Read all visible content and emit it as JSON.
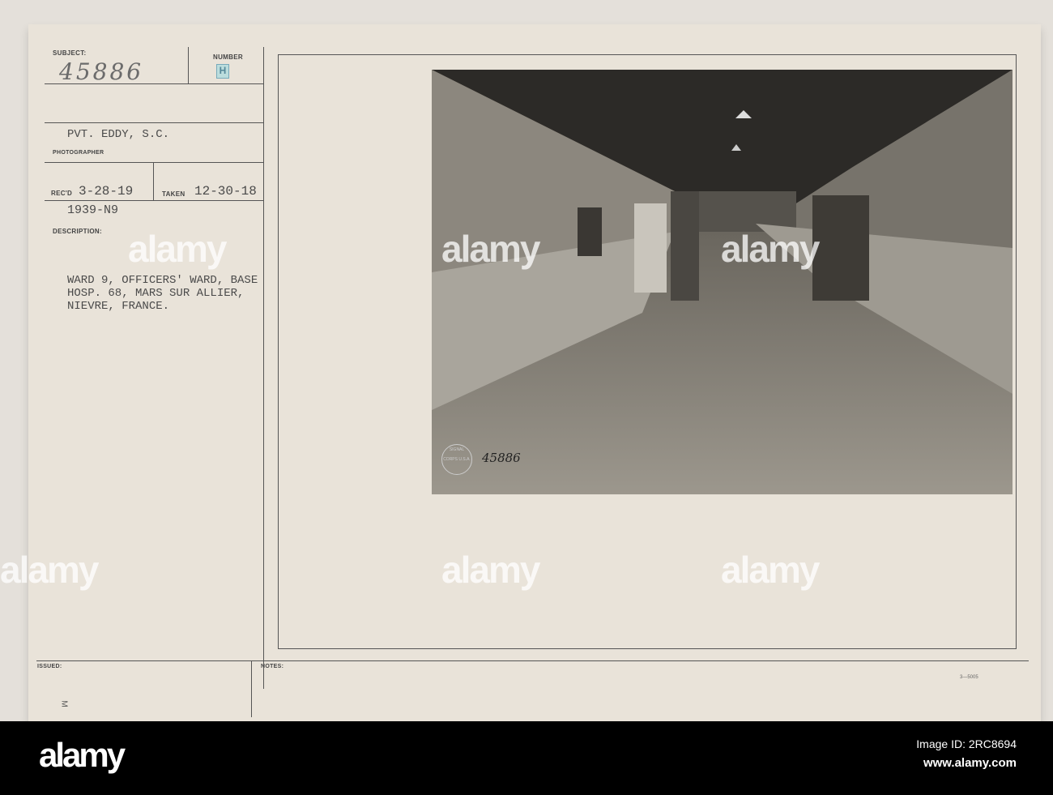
{
  "card": {
    "subject_label": "SUBJECT:",
    "subject_number": "45886",
    "number_label": "NUMBER",
    "number_stamp": "H",
    "photographer_name": "PVT. EDDY, S.C.",
    "photographer_label": "PHOTOGRAPHER",
    "recd_label": "REC'D",
    "recd_date": "3-28-19",
    "taken_label": "TAKEN",
    "taken_date": "12-30-18",
    "file_code": "1939-N9",
    "description_label": "DESCRIPTION:",
    "description_lines": [
      "WARD 9, OFFICERS' WARD, BASE",
      "HOSP. 68, MARS SUR ALLIER,",
      "NIEVRE, FRANCE."
    ],
    "issued_label": "ISSUED:",
    "issued_mark": "M",
    "notes_label": "NOTES:",
    "form_code": "3—5005"
  },
  "photo": {
    "handwritten_number": "45886",
    "stamp_text": "SIGNAL CORPS U.S.A."
  },
  "footer": {
    "logo": "alamy",
    "image_id": "Image ID: 2RC8694",
    "url": "www.alamy.com"
  },
  "watermark": "alamy"
}
